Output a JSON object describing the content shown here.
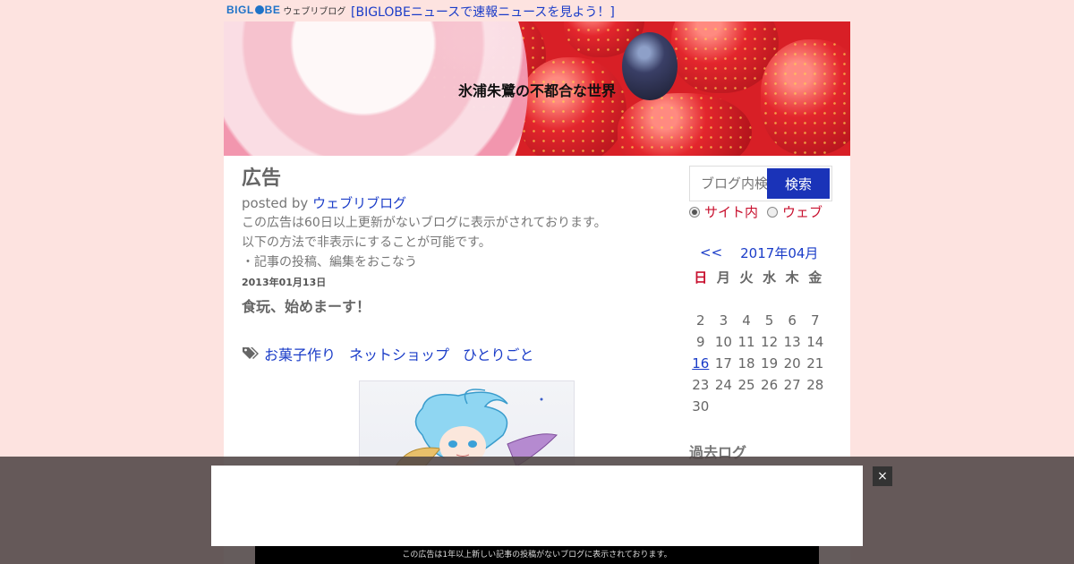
{
  "topbar": {
    "logo_text_left": "BIGL",
    "logo_text_right": "BE",
    "logo_sub": "ウェブリブログ",
    "news_link": "[BIGLOBEニュースで速報ニュースを見よう！]"
  },
  "header": {
    "site_title": "氷浦朱鷺の不都合な世界"
  },
  "ad_entry": {
    "title": "広告",
    "posted_prefix": "posted by ",
    "posted_author": "ウェブリブログ",
    "lines": [
      "この広告は60日以上更新がないブログに表示がされております。",
      "以下の方法で非表示にすることが可能です。",
      "・記事の投稿、編集をおこなう"
    ]
  },
  "entry": {
    "date": "2013年01月13日",
    "title": "食玩、始めまーす！",
    "tags": [
      "お菓子作り",
      "ネットショップ",
      "ひとりごと"
    ],
    "tag_icon": "tags-icon"
  },
  "search": {
    "placeholder": "ブログ内検索",
    "button": "検索",
    "scope_site": "サイト内",
    "scope_web": "ウェブ",
    "selected": "site"
  },
  "calendar": {
    "prev": "<<",
    "month": "2017年04月",
    "next": ">>",
    "weekdays": [
      "日",
      "月",
      "火",
      "水",
      "木",
      "金"
    ],
    "rows": [
      [
        "",
        "",
        "",
        "",
        "",
        ""
      ],
      [
        "2",
        "3",
        "4",
        "5",
        "6",
        "7"
      ],
      [
        "9",
        "10",
        "11",
        "12",
        "13",
        "14"
      ],
      [
        "16",
        "17",
        "18",
        "19",
        "20",
        "21"
      ],
      [
        "23",
        "24",
        "25",
        "26",
        "27",
        "28"
      ],
      [
        "30",
        "",
        "",
        "",
        "",
        ""
      ]
    ],
    "linked_day": "16"
  },
  "sidebar": {
    "archive_heading": "過去ログ"
  },
  "overlay": {
    "close_label": "×",
    "notice": "この広告は1年以上新しい記事の投稿がないブログに表示されております。"
  },
  "colors": {
    "page_bg": "#fde3e0",
    "link": "#1a3cc8",
    "search_button": "#1a33b8",
    "sunday": "#c8102e"
  }
}
